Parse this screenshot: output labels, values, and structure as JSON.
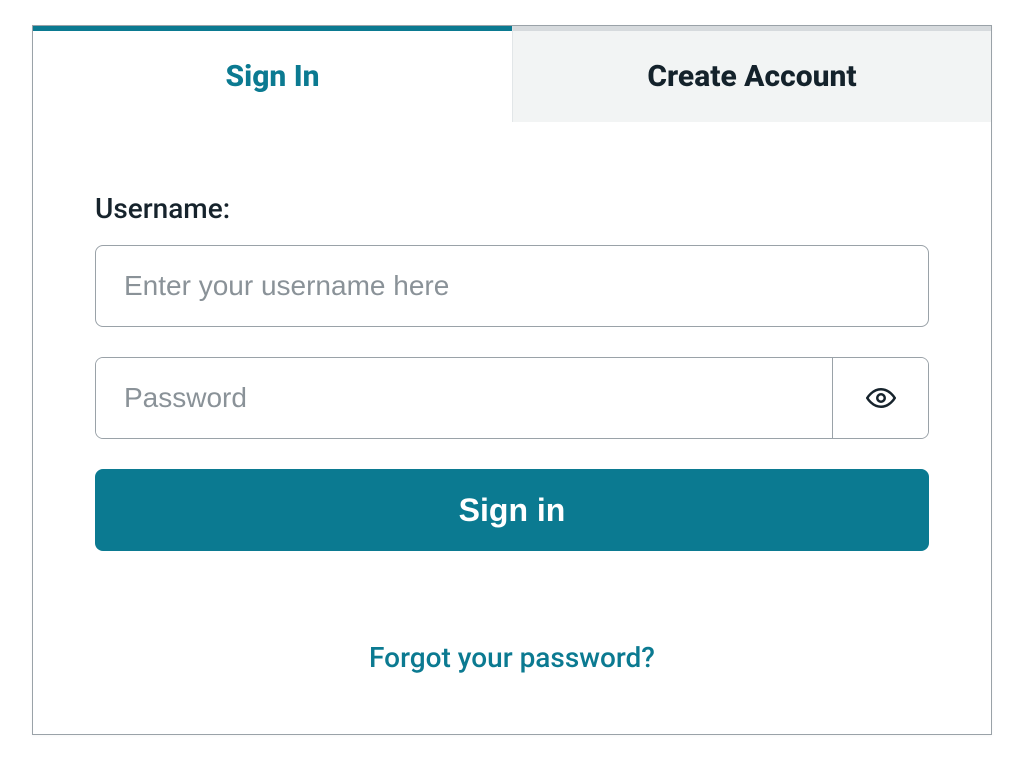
{
  "tabs": {
    "signin": "Sign In",
    "create": "Create Account"
  },
  "form": {
    "usernameLabel": "Username:",
    "usernamePlaceholder": "Enter your username here",
    "passwordPlaceholder": "Password",
    "submitLabel": "Sign in",
    "forgotLink": "Forgot your password?"
  }
}
